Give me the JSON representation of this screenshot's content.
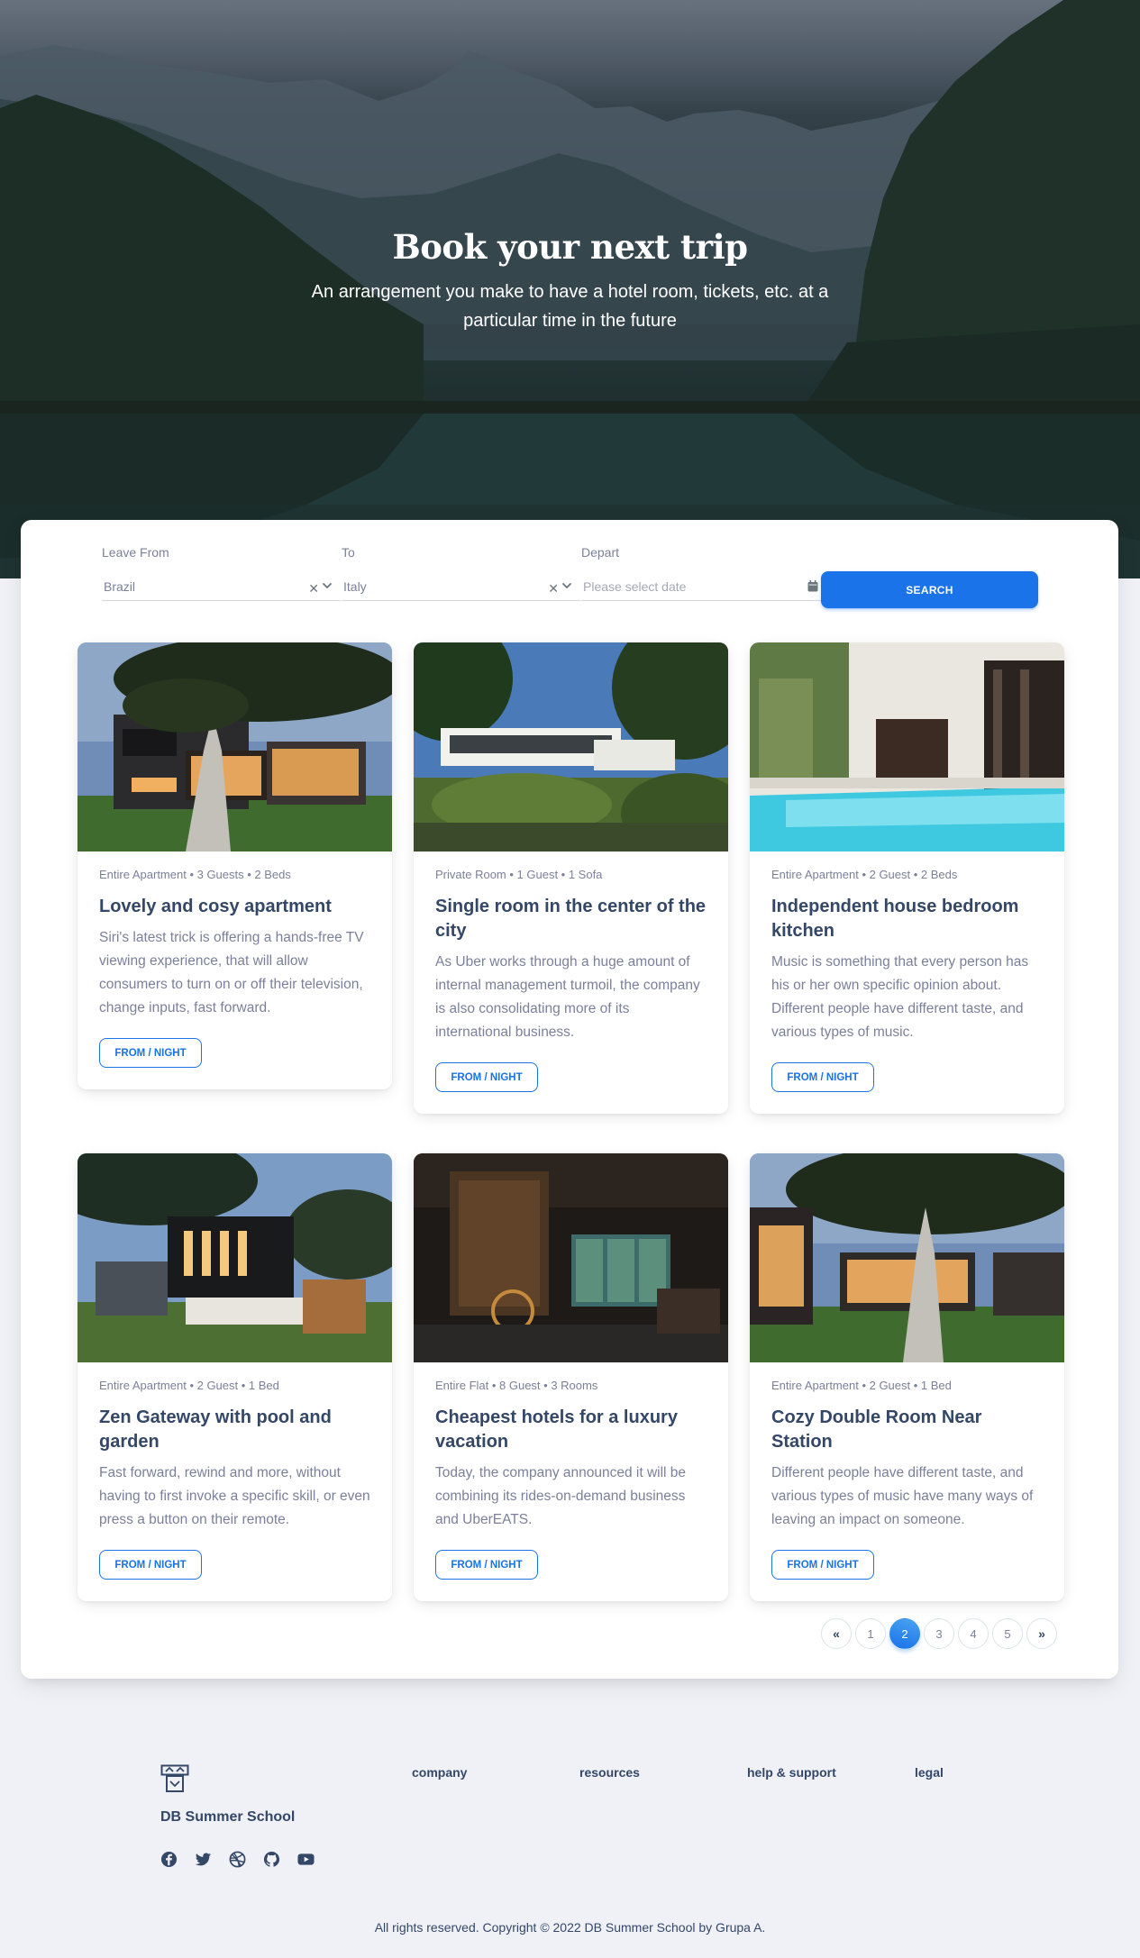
{
  "hero": {
    "title": "Book your next trip",
    "subtitle": "An arrangement you make to have a hotel room, tickets, etc. at a particular time in the future"
  },
  "search": {
    "leave_from": {
      "label": "Leave From",
      "value": "Brazil"
    },
    "to": {
      "label": "To",
      "value": "Italy"
    },
    "depart": {
      "label": "Depart",
      "placeholder": "Please select date"
    },
    "button_label": "SEARCH"
  },
  "listings": [
    {
      "meta": "Entire Apartment • 3 Guests • 2 Beds",
      "title": "Lovely and cosy apartment",
      "description": "Siri's latest trick is offering a hands-free TV viewing experience, that will allow consumers to turn on or off their television, change inputs, fast forward.",
      "button_label": "FROM / NIGHT"
    },
    {
      "meta": "Private Room • 1 Guest • 1 Sofa",
      "title": "Single room in the center of the city",
      "description": "As Uber works through a huge amount of internal management turmoil, the company is also consolidating more of its international business.",
      "button_label": "FROM / NIGHT"
    },
    {
      "meta": "Entire Apartment • 2 Guest • 2 Beds",
      "title": "Independent house bedroom kitchen",
      "description": "Music is something that every person has his or her own specific opinion about. Different people have different taste, and various types of music.",
      "button_label": "FROM / NIGHT"
    },
    {
      "meta": "Entire Apartment • 2 Guest • 1 Bed",
      "title": "Zen Gateway with pool and garden",
      "description": "Fast forward, rewind and more, without having to first invoke a specific skill, or even press a button on their remote.",
      "button_label": "FROM / NIGHT"
    },
    {
      "meta": "Entire Flat • 8 Guest • 3 Rooms",
      "title": "Cheapest hotels for a luxury vacation",
      "description": "Today, the company announced it will be combining its rides-on-demand business and UberEATS.",
      "button_label": "FROM / NIGHT"
    },
    {
      "meta": "Entire Apartment • 2 Guest • 1 Bed",
      "title": "Cozy Double Room Near Station",
      "description": "Different people have different taste, and various types of music have many ways of leaving an impact on someone.",
      "button_label": "FROM / NIGHT"
    }
  ],
  "pagination": {
    "prev": "«",
    "pages": [
      "1",
      "2",
      "3",
      "4",
      "5"
    ],
    "active_page": "2",
    "next": "»"
  },
  "footer": {
    "brand": "DB Summer School",
    "columns": [
      "company",
      "resources",
      "help & support",
      "legal"
    ],
    "social_icons": [
      "facebook-icon",
      "twitter-icon",
      "dribbble-icon",
      "github-icon",
      "youtube-icon"
    ],
    "copyright": "All rights reserved. Copyright © 2022 DB Summer School by Grupa A."
  },
  "colors": {
    "accent": "#1a73e8",
    "text_dark": "#344767",
    "text_muted": "#7b809a",
    "page_bg": "#eff1f6"
  }
}
